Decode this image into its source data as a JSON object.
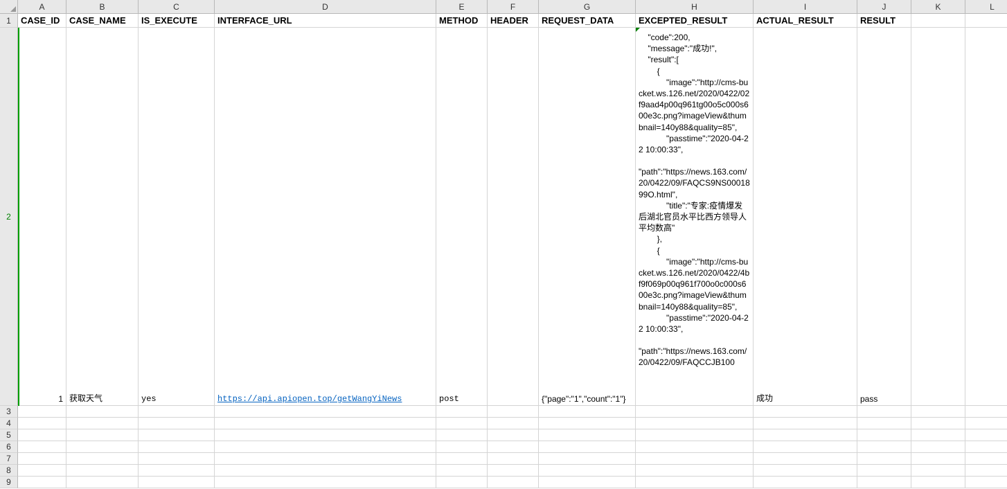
{
  "columns": [
    "A",
    "B",
    "C",
    "D",
    "E",
    "F",
    "G",
    "H",
    "I",
    "J",
    "K",
    "L"
  ],
  "rows": [
    "1",
    "2",
    "3",
    "4",
    "5",
    "6",
    "7",
    "8",
    "9"
  ],
  "headers": {
    "A": "CASE_ID",
    "B": "CASE_NAME",
    "C": "IS_EXECUTE",
    "D": "INTERFACE_URL",
    "E": "METHOD",
    "F": "HEADER",
    "G": "REQUEST_DATA",
    "H": "EXCEPTED_RESULT",
    "I": "ACTUAL_RESULT",
    "J": "RESULT"
  },
  "data_row": {
    "case_id": "1",
    "case_name": "获取天气",
    "is_execute": "yes",
    "interface_url": "https://api.apiopen.top/getWangYiNews",
    "method": "post",
    "header": "",
    "request_data": "{\"page\":\"1\",\"count\":\"1\"}",
    "excepted_result": "    \"code\":200,\n    \"message\":\"成功!\",\n    \"result\":[\n        {\n            \"image\":\"http://cms-bucket.ws.126.net/2020/0422/02f9aad4p00q961tg00o5c000s600e3c.png?imageView&thumbnail=140y88&quality=85\",\n            \"passtime\":\"2020-04-22 10:00:33\",\n\n\"path\":\"https://news.163.com/20/0422/09/FAQCS9NS0001899O.html\",\n            \"title\":\"专家:疫情爆发后湖北官员水平比西方领导人平均数高\"\n        },\n        {\n            \"image\":\"http://cms-bucket.ws.126.net/2020/0422/4bf9f069p00q961f700o0c000s600e3c.png?imageView&thumbnail=140y88&quality=85\",\n            \"passtime\":\"2020-04-22 10:00:33\",\n\n\"path\":\"https://news.163.com/20/0422/09/FAQCCJB100",
    "actual_result": "成功",
    "result": "pass"
  }
}
